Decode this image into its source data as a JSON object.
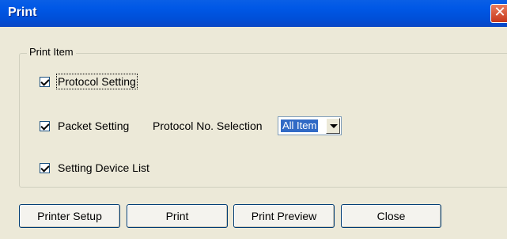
{
  "window": {
    "title": "Print",
    "close_glyph": "✕"
  },
  "print_item": {
    "legend": "Print Item",
    "items": [
      {
        "label": "Protocol Setting",
        "checked": true
      },
      {
        "label": "Packet Setting",
        "checked": true
      },
      {
        "label": "Setting Device List",
        "checked": true
      }
    ],
    "protocol_selection": {
      "label": "Protocol No. Selection",
      "value": "All Item"
    }
  },
  "buttons": {
    "printer_setup": "Printer Setup",
    "print": "Print",
    "print_preview": "Print Preview",
    "close": "Close"
  },
  "colors": {
    "titlebar": "#0058e6",
    "dialog_bg": "#ece9d8",
    "close": "#c7371a"
  },
  "icons": {
    "close": "close-icon",
    "checkbox": "checkmark-icon",
    "dropdown": "chevron-down-icon"
  }
}
